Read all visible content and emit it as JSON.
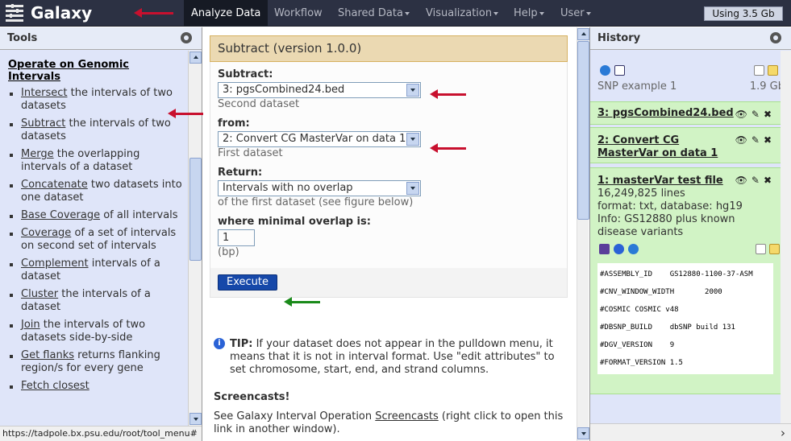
{
  "masthead": {
    "brand": "Galaxy",
    "nav": [
      {
        "label": "Analyze Data",
        "active": true,
        "dropdown": false
      },
      {
        "label": "Workflow",
        "active": false,
        "dropdown": false
      },
      {
        "label": "Shared Data",
        "active": false,
        "dropdown": true
      },
      {
        "label": "Visualization",
        "active": false,
        "dropdown": true
      },
      {
        "label": "Help",
        "active": false,
        "dropdown": true
      },
      {
        "label": "User",
        "active": false,
        "dropdown": true
      }
    ],
    "quota": "Using 3.5 Gb"
  },
  "tools_panel": {
    "title": "Tools",
    "section": "Operate on Genomic Intervals",
    "tools": [
      {
        "name": "Intersect",
        "desc": "the intervals of two datasets"
      },
      {
        "name": "Subtract",
        "desc": "the intervals of two datasets"
      },
      {
        "name": "Merge",
        "desc": "the overlapping intervals of a dataset"
      },
      {
        "name": "Concatenate",
        "desc": "two datasets into one dataset"
      },
      {
        "name": "Base Coverage",
        "desc": "of all intervals"
      },
      {
        "name": "Coverage",
        "desc": "of a set of intervals on second set of intervals"
      },
      {
        "name": "Complement",
        "desc": "intervals of a dataset"
      },
      {
        "name": "Cluster",
        "desc": "the intervals of a dataset"
      },
      {
        "name": "Join",
        "desc": "the intervals of two datasets side-by-side"
      },
      {
        "name": "Get flanks",
        "desc": "returns flanking region/s for every gene"
      },
      {
        "name": "Fetch closest",
        "desc": ""
      }
    ],
    "status_url": "https://tadpole.bx.psu.edu/root/tool_menu#"
  },
  "tool_form": {
    "title": "Subtract (version 1.0.0)",
    "subtract": {
      "label": "Subtract:",
      "value": "3: pgsCombined24.bed",
      "help": "Second dataset"
    },
    "from": {
      "label": "from:",
      "value": "2: Convert CG MasterVar on data 1",
      "help": "First dataset"
    },
    "returns": {
      "label": "Return:",
      "value": "Intervals with no overlap",
      "help": "of the first dataset (see figure below)"
    },
    "min_overlap": {
      "label": "where minimal overlap is:",
      "value": "1",
      "help": "(bp)"
    },
    "execute_label": "Execute",
    "tip_label": "TIP:",
    "tip_text": "If your dataset does not appear in the pulldown menu, it means that it is not in interval format. Use \"edit attributes\" to set chromosome, start, end, and strand columns.",
    "screencasts_title": "Screencasts!",
    "screencasts_pre": "See Galaxy Interval Operation",
    "screencasts_link": "Screencasts",
    "screencasts_post": "(right click to open this link in another window)."
  },
  "history": {
    "title": "History",
    "name": "SNP example 1",
    "size": "1.9 Gb",
    "datasets": [
      {
        "title": "3: pgsCombined24.bed"
      },
      {
        "title": "2: Convert CG MasterVar on data 1"
      },
      {
        "title": "1: masterVar test file",
        "lines": "16,249,825 lines",
        "format": "format: txt, database: hg19",
        "info": "Info: GS12880 plus known disease variants"
      }
    ],
    "peek": [
      "#ASSEMBLY_ID    GS12880-1100-37-ASM",
      "#CNV_WINDOW_WIDTH       2000",
      "#COSMIC COSMIC v48",
      "#DBSNP_BUILD    dbSNP build 131",
      "#DGV_VERSION    9",
      "#FORMAT_VERSION 1.5"
    ]
  },
  "colors": {
    "masthead": "#2c3143",
    "panel": "#dfe5f9",
    "dataset_ok": "#d1f3c5",
    "form_header": "#ebd9b2",
    "execute": "#1648a9",
    "annotation_red": "#c8102e",
    "annotation_green": "#1a8a1a"
  }
}
